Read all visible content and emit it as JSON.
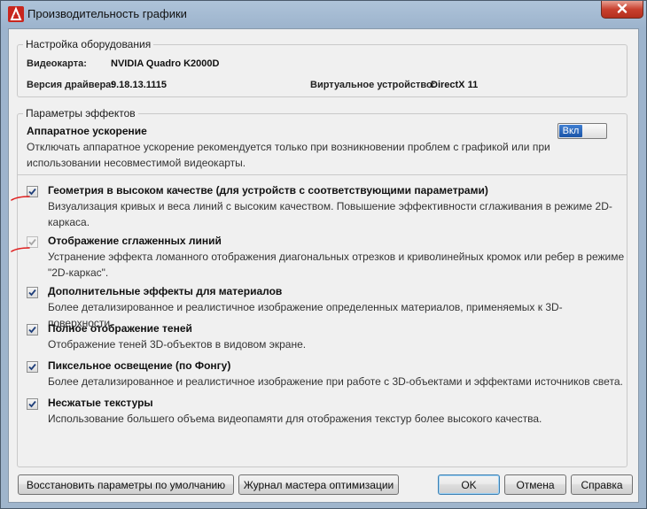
{
  "window": {
    "title": "Производительность графики"
  },
  "hardware": {
    "legend": "Настройка оборудования",
    "videocard_label": "Видеокарта:",
    "videocard_value": "NVIDIA Quadro K2000D",
    "driver_label": "Версия драйвера:",
    "driver_value": "9.18.13.1115",
    "virtual_label": "Виртуальное устройство:",
    "virtual_value": "DirectX 11"
  },
  "effects": {
    "legend": "Параметры эффектов",
    "hw_accel": {
      "title": "Аппаратное ускорение",
      "desc_line1": "Отключать аппаратное ускорение рекомендуется только при возникновении проблем с графикой или при",
      "desc_line2": "использовании несовместимой видеокарты.",
      "toggle_label": "Вкл",
      "state": "on"
    },
    "options": [
      {
        "title": "Геометрия в высоком качестве (для устройств с соответствующими параметрами)",
        "desc1": "Визуализация кривых и веса линий с высоким качеством. Повышение эффективности сглаживания в режиме 2D-",
        "desc2": "каркаса.",
        "checked": true,
        "enabled": true
      },
      {
        "title": "Отображение сглаженных линий",
        "desc1": "Устранение эффекта ломанного отображения диагональных отрезков и криволинейных кромок или ребер в режиме",
        "desc2": "\"2D-каркас\".",
        "checked": true,
        "enabled": false
      },
      {
        "title": "Дополнительные эффекты для материалов",
        "desc1": "Более детализированное и реалистичное изображение определенных материалов, применяемых к 3D-поверхности.",
        "checked": true,
        "enabled": true
      },
      {
        "title": "Полное отображение теней",
        "desc1": "Отображение теней 3D-объектов в видовом экране.",
        "checked": true,
        "enabled": true
      },
      {
        "title": "Пиксельное освещение (по Фонгу)",
        "desc1": "Более детализированное и реалистичное изображение при работе с 3D-объектами и эффектами источников света.",
        "checked": true,
        "enabled": true
      },
      {
        "title": "Несжатые текстуры",
        "desc1": "Использование большего объема видеопамяти для отображения текстур более высокого качества.",
        "checked": true,
        "enabled": true
      }
    ]
  },
  "buttons": {
    "restore": "Восстановить параметры по умолчанию",
    "wizard": "Журнал мастера оптимизации",
    "ok": "OK",
    "cancel": "Отмена",
    "help": "Справка"
  },
  "colors": {
    "accent": "#1b55a8",
    "annotation": "#e02020",
    "close": "#c8412f"
  }
}
